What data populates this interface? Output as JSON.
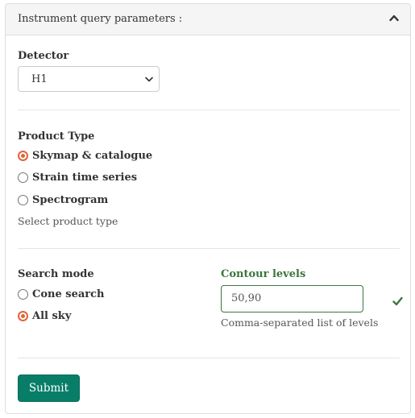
{
  "panel": {
    "title": "Instrument query parameters :",
    "collapse_icon": "chevron-up-icon"
  },
  "detector": {
    "label": "Detector",
    "selected": "H1"
  },
  "product_type": {
    "label": "Product Type",
    "options": [
      {
        "label": "Skymap & catalogue",
        "checked": true
      },
      {
        "label": "Strain time series",
        "checked": false
      },
      {
        "label": "Spectrogram",
        "checked": false
      }
    ],
    "help": "Select product type"
  },
  "search_mode": {
    "label": "Search mode",
    "options": [
      {
        "label": "Cone search",
        "checked": false
      },
      {
        "label": "All sky",
        "checked": true
      }
    ]
  },
  "contour_levels": {
    "label": "Contour levels",
    "value": "50,90",
    "help": "Comma-separated list of levels",
    "valid_icon": "checkmark-icon"
  },
  "submit": {
    "label": "Submit"
  },
  "colors": {
    "accent_radio": "#e0643a",
    "valid_green": "#3c763d",
    "submit_bg": "#087e68"
  }
}
